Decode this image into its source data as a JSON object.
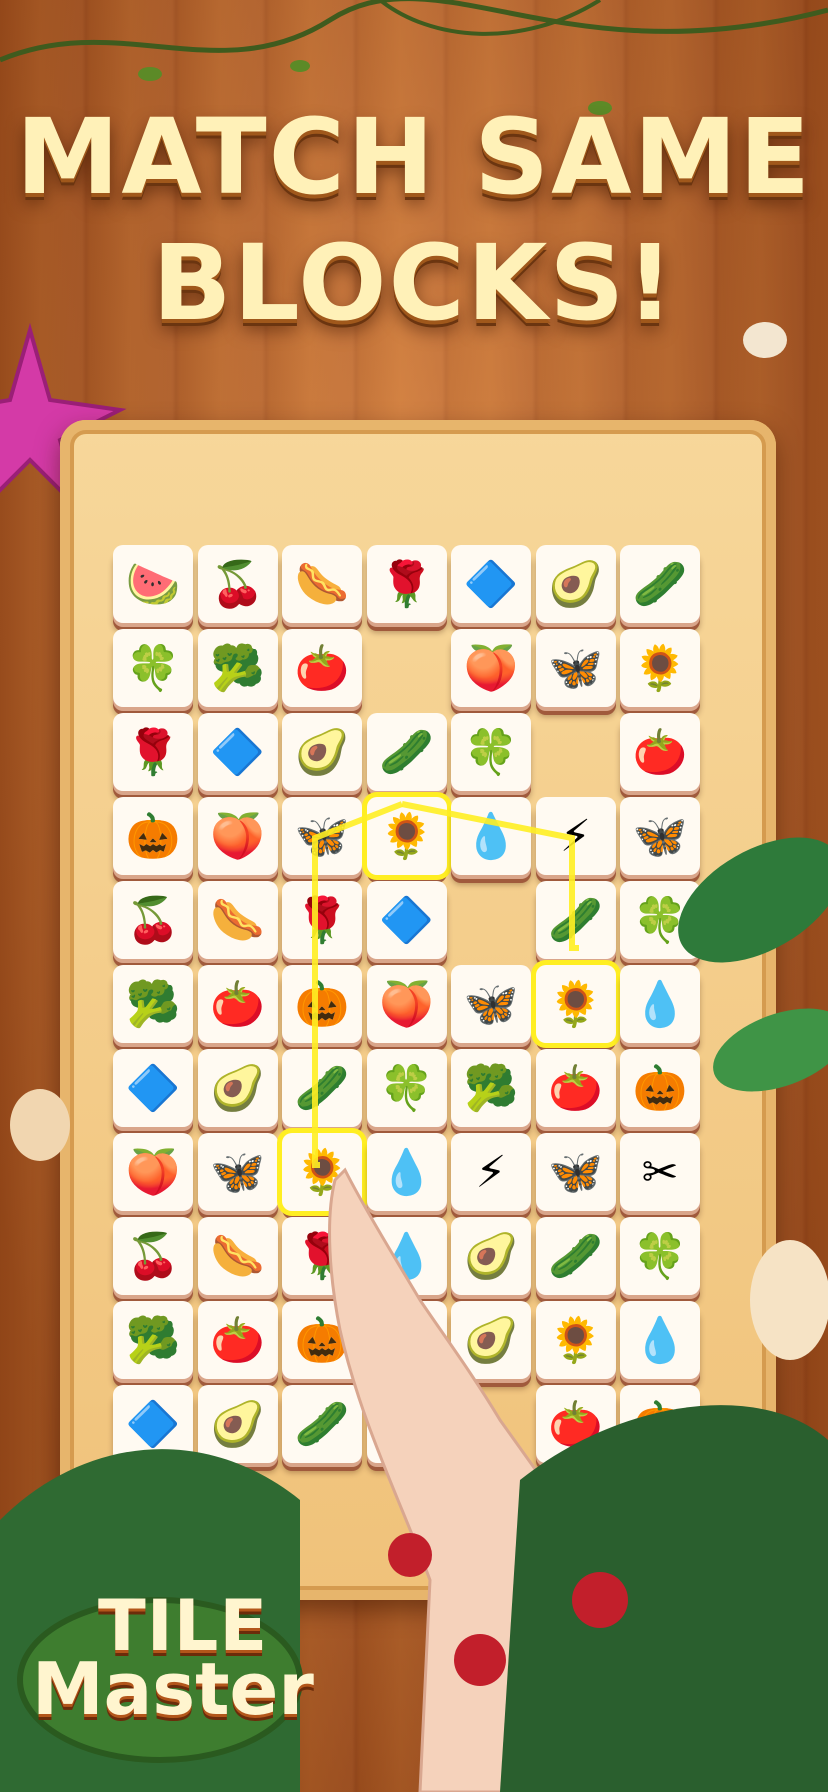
{
  "headline": {
    "line1": "MATCH SAME",
    "line2": "BLOCKS!"
  },
  "logo": {
    "line1": "TILE",
    "line2": "Master"
  },
  "colors": {
    "title_fill": "#fff1b8",
    "title_outline": "#a0581b",
    "selection": "#ffee22",
    "board": "#f7d79a"
  },
  "board": {
    "rows": [
      [
        "watermelon",
        "cherries",
        "sausage",
        "rose",
        "pinwheel",
        "avocado",
        "cucumber"
      ],
      [
        "clover",
        "broccoli",
        "tomato",
        "",
        "peach",
        "dragonfly",
        "sunflower"
      ],
      [
        "rose",
        "pinwheel",
        "avocado",
        "cucumber",
        "clover",
        "",
        "tomato"
      ],
      [
        "papaya",
        "peach",
        "dragonfly",
        "sunflower",
        "flame",
        "lightning",
        "butterfly"
      ],
      [
        "cherries",
        "sausage",
        "rose",
        "pinwheel",
        "",
        "cucumber",
        "clover"
      ],
      [
        "broccoli",
        "tomato",
        "papaya",
        "peach",
        "dragonfly",
        "sunflower",
        "flame"
      ],
      [
        "pinwheel",
        "avocado",
        "cucumber",
        "clover",
        "broccoli",
        "tomato",
        "papaya"
      ],
      [
        "peach",
        "dragonfly",
        "sunflower",
        "flame",
        "lightning",
        "butterfly",
        "scissors"
      ],
      [
        "cherries",
        "sausage",
        "rose",
        "flame",
        "avocado",
        "cucumber",
        "clover"
      ],
      [
        "broccoli",
        "tomato",
        "papaya",
        "cucumber",
        "avocado",
        "sunflower",
        "flame"
      ],
      [
        "pinwheel",
        "avocado",
        "cucumber",
        "clover",
        "",
        "tomato",
        "papaya"
      ]
    ],
    "selected": [
      [
        3,
        3
      ],
      [
        5,
        5
      ],
      [
        7,
        2
      ]
    ]
  },
  "icons": {
    "watermelon": "🍉",
    "cherries": "🍒",
    "sausage": "🌭",
    "rose": "🌹",
    "pinwheel": "🔷",
    "avocado": "🥑",
    "cucumber": "🥒",
    "clover": "🍀",
    "broccoli": "🥦",
    "tomato": "🍅",
    "peach": "🍑",
    "dragonfly": "🦋",
    "sunflower": "🌻",
    "papaya": "🎃",
    "flame": "💧",
    "lightning": "⚡",
    "butterfly": "🦋",
    "scissors": "✂"
  }
}
